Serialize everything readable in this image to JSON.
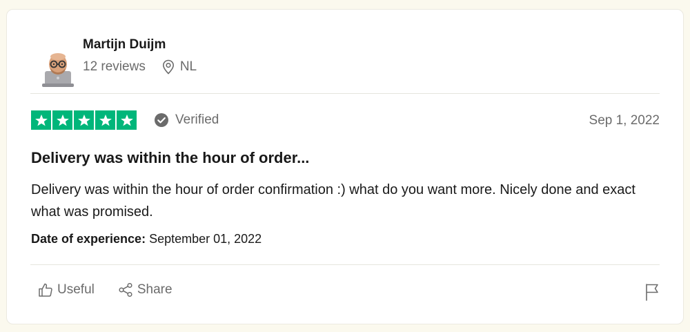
{
  "reviewer": {
    "name": "Martijn Duijm",
    "reviews": "12 reviews",
    "country": "NL"
  },
  "review": {
    "rating": 5,
    "verified_label": "Verified",
    "date": "Sep 1, 2022",
    "title": "Delivery was within the hour of order...",
    "body": "Delivery was within the hour of order confirmation :) what do you want more. Nicely done and exact what was promised.",
    "experience_label": "Date of experience:",
    "experience_date": "September 01, 2022"
  },
  "actions": {
    "useful_label": "Useful",
    "share_label": "Share"
  },
  "colors": {
    "star_green": "#00b67a",
    "page_bg": "#fbf9ee",
    "muted_text": "#6b6b6b"
  },
  "icons": [
    "avatar-icon",
    "location-pin-icon",
    "star-icon",
    "verified-check-icon",
    "thumbs-up-icon",
    "share-icon",
    "flag-icon"
  ]
}
